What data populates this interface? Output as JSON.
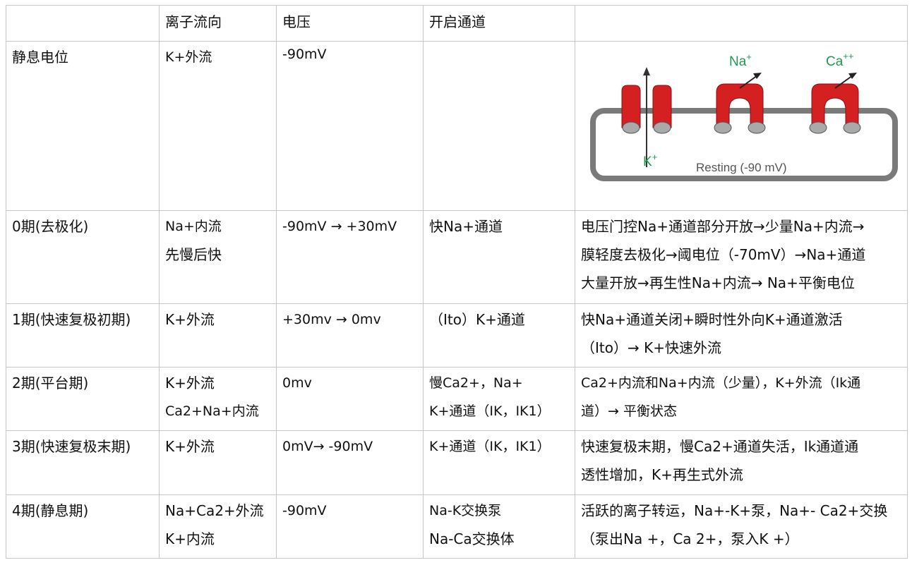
{
  "headers": [
    "",
    "离子流向",
    "电压",
    "开启通道",
    ""
  ],
  "rows": [
    {
      "phase": "静息电位",
      "ion_flow": [
        "K+外流"
      ],
      "voltage": "-90mV",
      "channels": [],
      "description": []
    },
    {
      "phase": "0期(去极化)",
      "ion_flow": [
        "Na+内流",
        "先慢后快"
      ],
      "voltage": "-90mV → +30mV",
      "channels": [
        "快Na+通道"
      ],
      "description": [
        "电压门控Na+通道部分开放→少量Na+内流→",
        "膜轻度去极化→阈电位（-70mV）→Na+通道",
        "大量开放→再生性Na+内流→ Na+平衡电位"
      ]
    },
    {
      "phase": "1期(快速复极初期)",
      "ion_flow": [
        "K+外流"
      ],
      "voltage": "+30mv → 0mv",
      "channels": [
        "（Ito）K+通道"
      ],
      "description": [
        "快Na+通道关闭+瞬时性外向K+通道激活",
        "（Ito）→  K+快速外流"
      ]
    },
    {
      "phase": "2期(平台期)",
      "ion_flow": [
        "K+外流",
        "Ca2+Na+内流"
      ],
      "voltage": "0mv",
      "channels": [
        "慢Ca2+，Na+",
        "K+通道（IK，IK1）"
      ],
      "description": [
        "Ca2+内流和Na+内流（少量），K+外流（Ik通",
        "道）→ 平衡状态"
      ]
    },
    {
      "phase": "3期(快速复极末期)",
      "ion_flow": [
        "K+外流"
      ],
      "voltage": "0mV→  -90mV",
      "channels": [
        "K+通道（IK，IK1）"
      ],
      "description": [
        "快速复极末期，慢Ca2+通道失活，Ik通道通",
        "透性增加，K+再生式外流"
      ]
    },
    {
      "phase": "4期(静息期)",
      "ion_flow": [
        "Na+Ca2+外流",
        "K+内流"
      ],
      "voltage": "-90mV",
      "channels": [
        "Na-K交换泵",
        "Na-Ca交换体"
      ],
      "description": [
        "活跃的离子转运，Na+-K+泵，Na+- Ca2+交换",
        "（泵出Na +，Ca 2+，泵入K +）"
      ]
    }
  ],
  "diagram": {
    "label_na": "Na",
    "label_na_sup": "+",
    "label_ca": "Ca",
    "label_ca_sup": "++",
    "label_k": "K",
    "label_k_sup": "+",
    "caption": "Resting (-90 mV)",
    "colors": {
      "channel": "#d42020",
      "membrane": "#7a7a7a",
      "ion_label": "#1e9a50",
      "gate": "#a9a9a9"
    }
  }
}
